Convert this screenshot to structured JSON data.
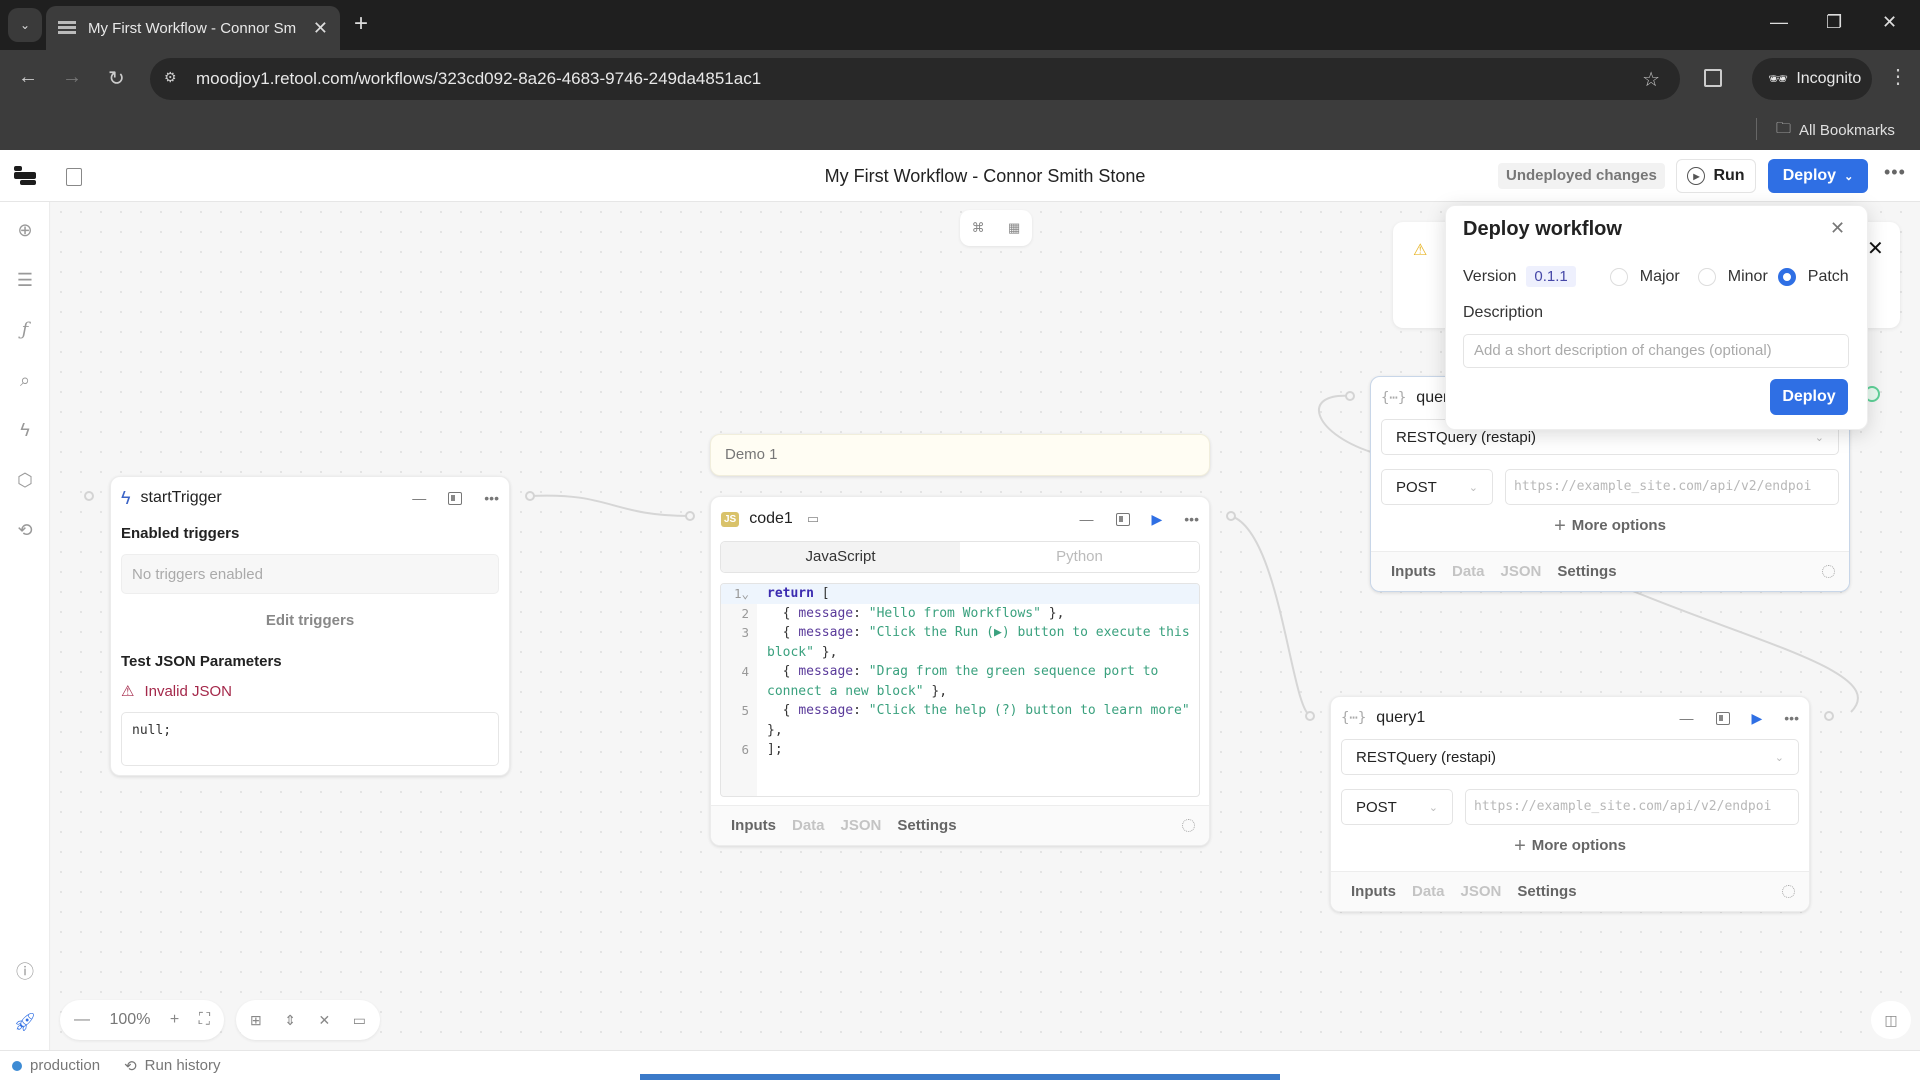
{
  "browser": {
    "tab_title": "My First Workflow - Connor Sm",
    "tab_close": "✕",
    "new_tab": "+",
    "url": "moodjoy1.retool.com/workflows/323cd092-8a26-4683-9746-249da4851ac1",
    "incognito_label": "Incognito",
    "bookmarks_label": "All Bookmarks"
  },
  "header": {
    "title": "My First Workflow - Connor Smith Stone",
    "undeployed": "Undeployed changes",
    "run_label": "Run",
    "deploy_label": "Deploy"
  },
  "canvas": {
    "note_label": "Demo 1",
    "layout_icons": [
      "graph-icon",
      "grid-icon"
    ]
  },
  "start_trigger": {
    "name": "startTrigger",
    "enabled_label": "Enabled triggers",
    "no_triggers": "No triggers enabled",
    "edit_triggers": "Edit triggers",
    "test_params_label": "Test JSON Parameters",
    "error": "Invalid JSON",
    "json_value": "null;"
  },
  "code1": {
    "name": "code1",
    "tabs": [
      "JavaScript",
      "Python"
    ],
    "active_tab": "JavaScript",
    "lines": [
      {
        "n": "1",
        "html": "<span class=\"kw\">return</span> ["
      },
      {
        "n": "2",
        "html": "  { <span class=\"prop\">message</span>: <span class=\"str\">\"Hello from Workflows\"</span> },"
      },
      {
        "n": "3",
        "html": "  { <span class=\"prop\">message</span>: <span class=\"str\">\"Click the Run (▶) button to execute this block\"</span> },"
      },
      {
        "n": "4",
        "html": "  { <span class=\"prop\">message</span>: <span class=\"str\">\"Drag from the green sequence port to connect a new block\"</span> },"
      },
      {
        "n": "5",
        "html": "  { <span class=\"prop\">message</span>: <span class=\"str\">\"Click the help (?) button to learn more\"</span> },"
      },
      {
        "n": "6",
        "html": "];"
      }
    ],
    "footer_tabs": [
      "Inputs",
      "Data",
      "JSON",
      "Settings"
    ]
  },
  "query_top": {
    "name": "quer",
    "resource": "RESTQuery (restapi)",
    "method": "POST",
    "url_placeholder": "https://example_site.com/api/v2/endpoi",
    "more_options": "More options",
    "footer_tabs": [
      "Inputs",
      "Data",
      "JSON",
      "Settings"
    ]
  },
  "query1": {
    "name": "query1",
    "resource": "RESTQuery (restapi)",
    "method": "POST",
    "url_placeholder": "https://example_site.com/api/v2/endpoi",
    "more_options": "More options",
    "footer_tabs": [
      "Inputs",
      "Data",
      "JSON",
      "Settings"
    ]
  },
  "deploy_popover": {
    "title": "Deploy workflow",
    "version_label": "Version",
    "version": "0.1.1",
    "options": [
      "Major",
      "Minor",
      "Patch"
    ],
    "selected": "Patch",
    "description_label": "Description",
    "description_placeholder": "Add a short description of changes (optional)",
    "deploy_label": "Deploy"
  },
  "toolbar": {
    "zoom": "100%"
  },
  "statusbar": {
    "environment": "production",
    "run_history": "Run history"
  },
  "colors": {
    "accent": "#2f6fe4",
    "error": "#a4284a",
    "warning": "#e7b52a",
    "string": "#3aa17e"
  }
}
